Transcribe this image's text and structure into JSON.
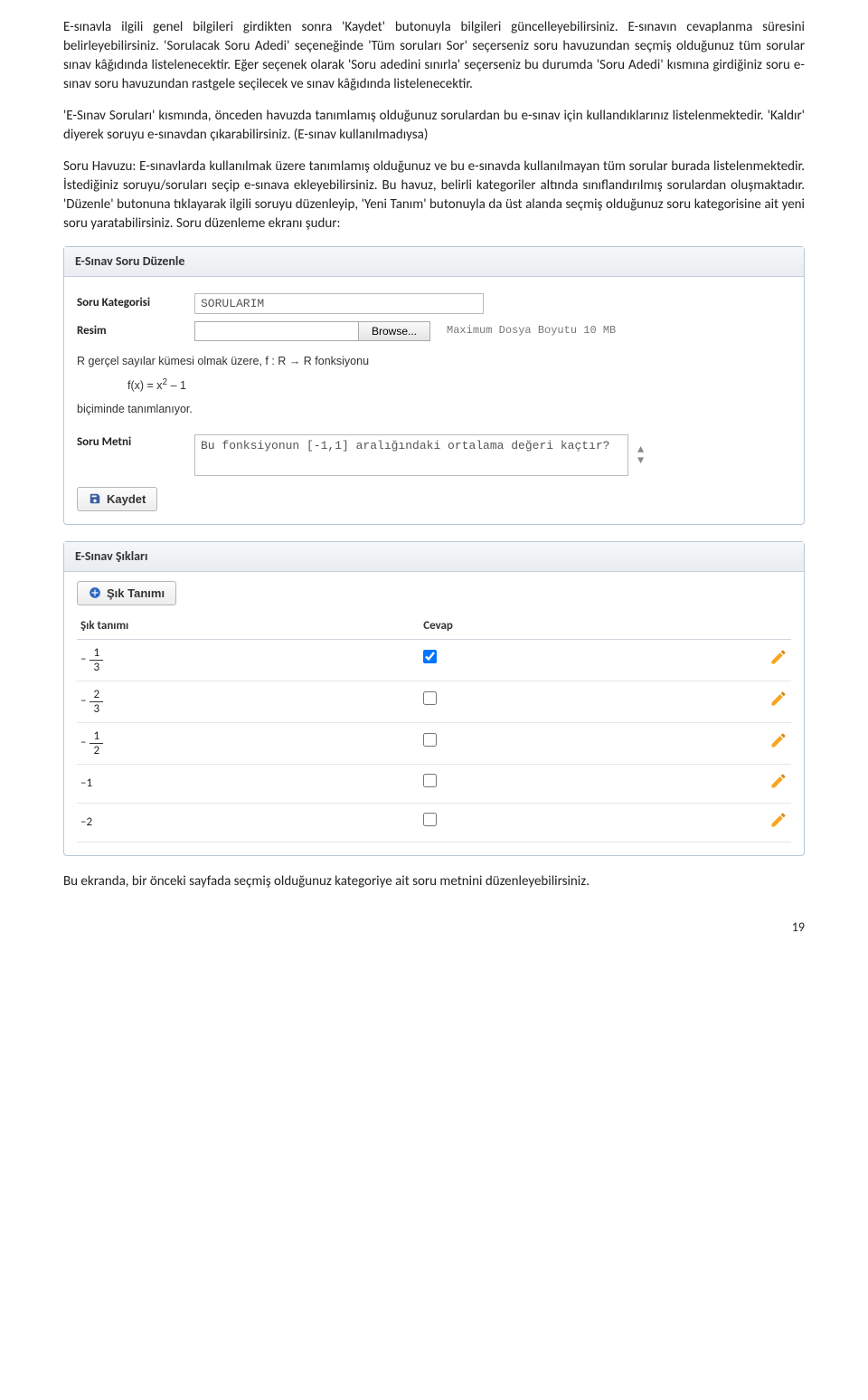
{
  "p1": "E-sınavla ilgili genel bilgileri girdikten sonra 'Kaydet' butonuyla bilgileri güncelleyebilirsiniz. E-sınavın cevaplanma süresini belirleyebilirsiniz. 'Sorulacak Soru Adedi' seçeneğinde 'Tüm soruları Sor' seçerseniz soru havuzundan seçmiş olduğunuz tüm sorular sınav kâğıdında listelenecektir. Eğer seçenek olarak 'Soru adedini sınırla' seçerseniz bu durumda 'Soru Adedi' kısmına girdiğiniz soru e-sınav soru havuzundan rastgele seçilecek ve sınav kâğıdında listelenecektir.",
  "p2": " 'E-Sınav Soruları' kısmında, önceden havuzda tanımlamış olduğunuz sorulardan bu e-sınav için kullandıklarınız listelenmektedir. 'Kaldır' diyerek soruyu e-sınavdan çıkarabilirsiniz. (E-sınav kullanılmadıysa)",
  "p3": "Soru Havuzu: E-sınavlarda kullanılmak üzere tanımlamış olduğunuz ve bu e-sınavda kullanılmayan tüm sorular burada listelenmektedir. İstediğiniz soruyu/soruları seçip e-sınava ekleyebilirsiniz. Bu havuz, belirli kategoriler altında sınıflandırılmış sorulardan oluşmaktadır. 'Düzenle' butonuna tıklayarak ilgili soruyu düzenleyip, 'Yeni Tanım' butonuyla da üst alanda seçmiş olduğunuz soru kategorisine ait yeni soru yaratabilirsiniz. Soru düzenleme ekranı şudur:",
  "p4": "Bu ekranda, bir önceki sayfada seçmiş olduğunuz kategoriye ait soru metnini düzenleyebilirsiniz.",
  "panel_edit": {
    "title": "E-Sınav Soru Düzenle",
    "kategori_label": "Soru Kategorisi",
    "kategori_value": "SORULARIM",
    "resim_label": "Resim",
    "browse": "Browse...",
    "max_hint": "Maximum Dosya Boyutu 10 MB",
    "math_1": "R gerçel sayılar kümesi olmak üzere, f : R → R fonksiyonu",
    "math_2": "f(x) = x",
    "math_exp": "2",
    "math_3": " – 1",
    "math_4": "biçiminde tanımlanıyor.",
    "metin_label": "Soru Metni",
    "metin_value": "Bu fonksiyonun [-1,1] aralığındaki ortalama değeri kaçtır?",
    "kaydet": "Kaydet"
  },
  "panel_siklar": {
    "title": "E-Sınav Şıkları",
    "sik_tanimi_btn": "Şık Tanımı",
    "col_sik": "Şık tanımı",
    "col_cevap": "Cevap",
    "rows": [
      {
        "neg": true,
        "num": "1",
        "den": "3",
        "plain": "",
        "checked": true
      },
      {
        "neg": true,
        "num": "2",
        "den": "3",
        "plain": "",
        "checked": false
      },
      {
        "neg": true,
        "num": "1",
        "den": "2",
        "plain": "",
        "checked": false
      },
      {
        "neg": false,
        "num": "",
        "den": "",
        "plain": "–1",
        "checked": false
      },
      {
        "neg": false,
        "num": "",
        "den": "",
        "plain": "–2",
        "checked": false
      }
    ]
  },
  "page_no": "19"
}
